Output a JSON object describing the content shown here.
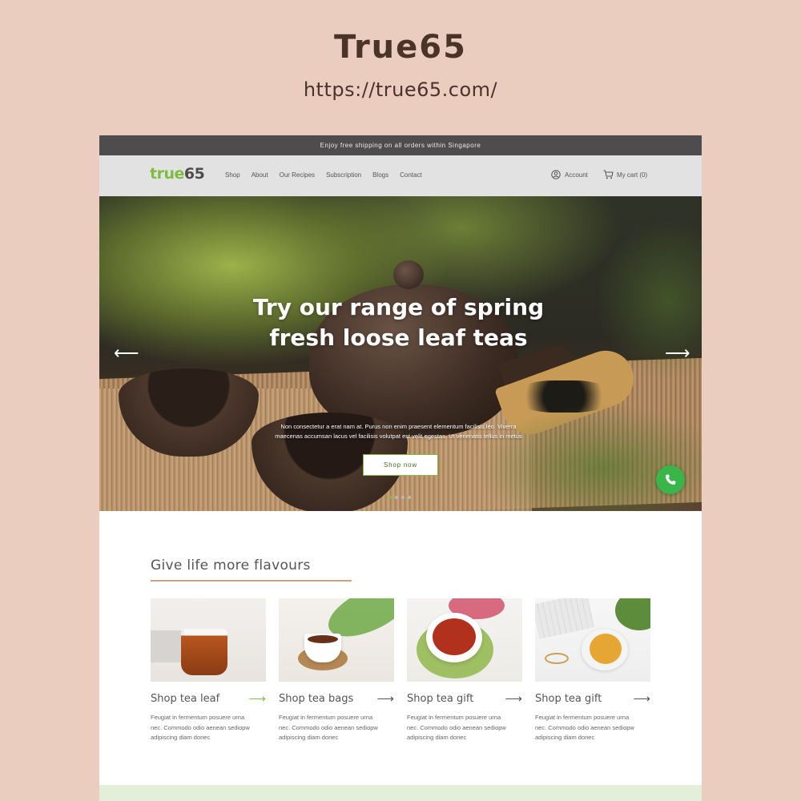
{
  "showcase": {
    "title": "True65",
    "url": "https://true65.com/"
  },
  "announcement": "Enjoy free shipping on all orders within Singapore",
  "logo": {
    "part1": "true",
    "part2": "65"
  },
  "nav": {
    "items": [
      "Shop",
      "About",
      "Our Recipes",
      "Subscription",
      "Blogs",
      "Contact"
    ],
    "account_label": "Account",
    "cart_label": "My cart (0)"
  },
  "hero": {
    "title_line1": "Try our range of spring",
    "title_line2": "fresh loose leaf teas",
    "text_line1": "Non consectetur a erat nam at. Purus non enim praesent elementum facilisis leo. Viverra",
    "text_line2": "maecenas accumsan lacus vel facilisis volutpat est velit egestas. Ut venenatis tellus in metus",
    "button_label": "Shop now",
    "slide_count": 4,
    "active_slide": 1
  },
  "section": {
    "title": "Give life more flavours"
  },
  "cards": [
    {
      "title": "Shop tea leaf",
      "desc1": "Feugiat in fermentum posuere urna",
      "desc2": "nec. Commodo odio aenean sediopw",
      "desc3": "adipiscing diam donec",
      "arrow_color": "green"
    },
    {
      "title": "Shop tea bags",
      "desc1": "Feugiat in fermentum posuere urna",
      "desc2": "nec. Commodo odio aenean sediopw",
      "desc3": "adipiscing diam donec",
      "arrow_color": "gray"
    },
    {
      "title": "Shop tea gift",
      "desc1": "Feugiat in fermentum posuere urna",
      "desc2": "nec. Commodo odio aenean sediopw",
      "desc3": "adipiscing diam donec",
      "arrow_color": "gray"
    },
    {
      "title": "Shop tea gift",
      "desc1": "Feugiat in fermentum posuere urna",
      "desc2": "nec. Commodo odio aenean sediopw",
      "desc3": "adipiscing diam donec",
      "arrow_color": "gray"
    }
  ],
  "icons": {
    "account": "user-circle-icon",
    "cart": "shopping-cart-icon",
    "prev": "arrow-left-icon",
    "next": "arrow-right-icon",
    "chat": "whatsapp-icon"
  },
  "colors": {
    "background": "#ebcdbf",
    "brand_green": "#7ebd42",
    "announcement_bar": "#4e4c4d",
    "nav_bar": "#e2e2e2",
    "whatsapp": "#3ab54a",
    "footer_band": "#e3efd8"
  }
}
